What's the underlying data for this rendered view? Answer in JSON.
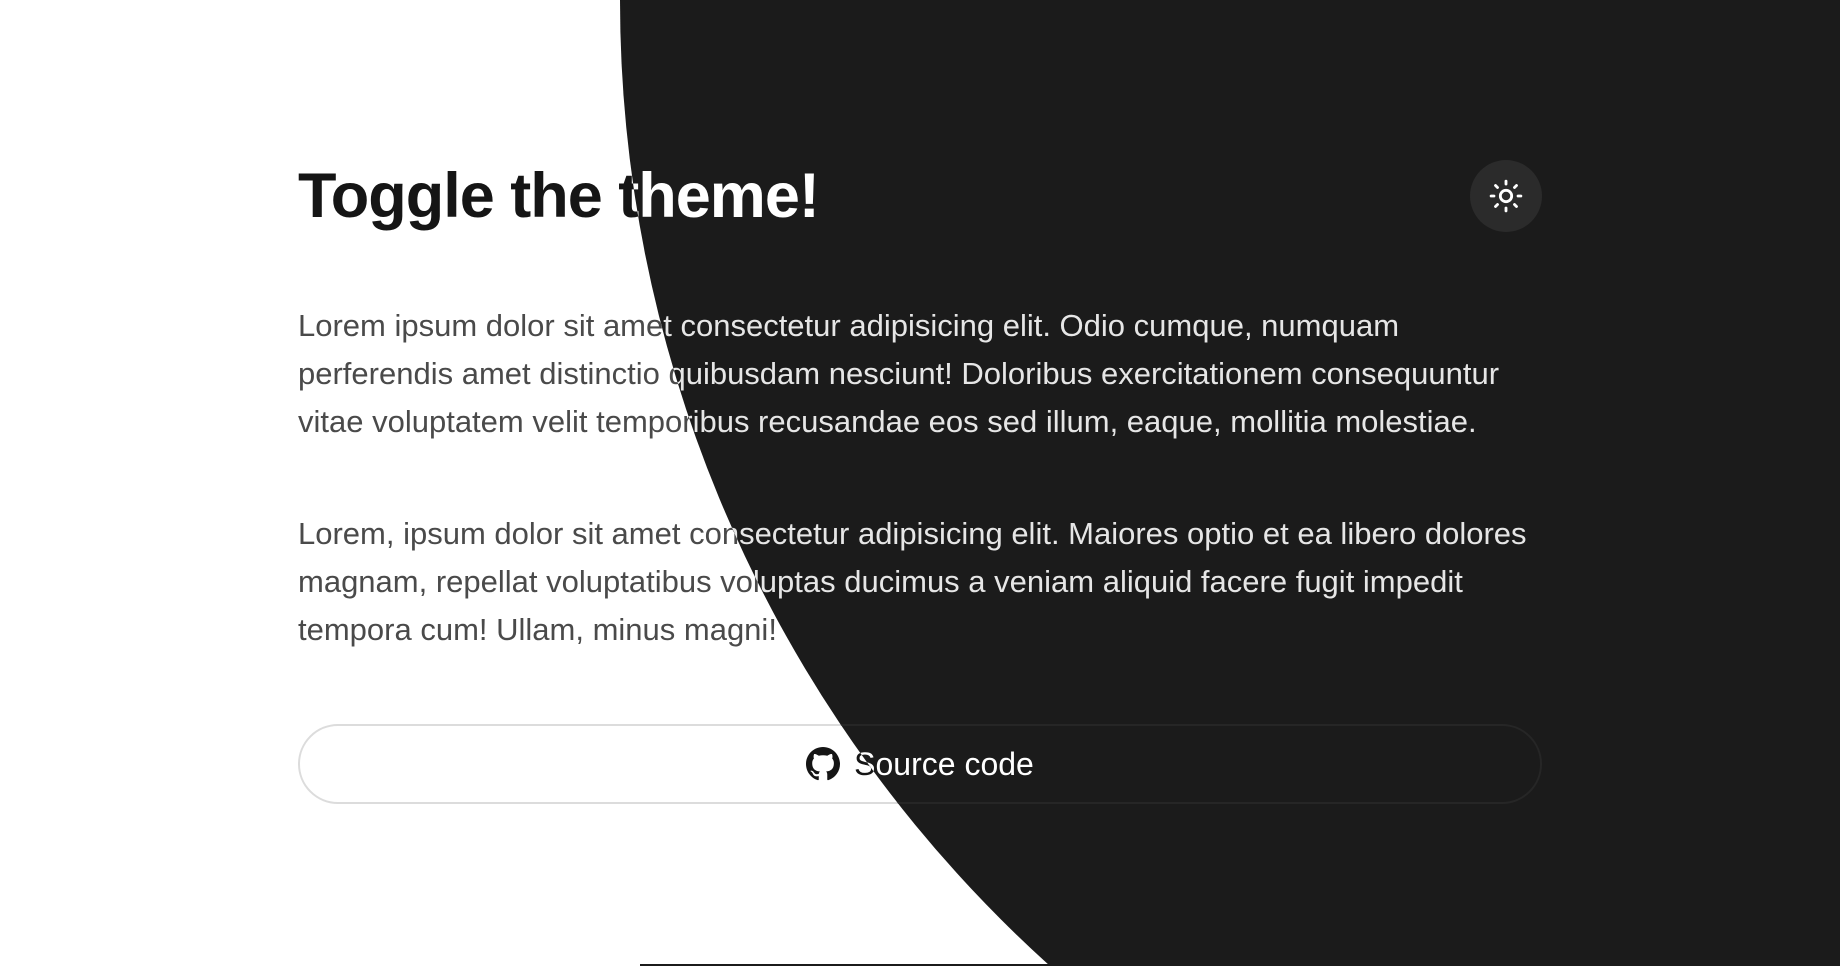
{
  "header": {
    "title": "Toggle the theme!"
  },
  "theme_toggle": {
    "icon": "sun-icon"
  },
  "content": {
    "paragraph_1": "Lorem ipsum dolor sit amet consectetur adipisicing elit. Odio cumque, numquam perferendis amet distinctio quibusdam nesciunt! Doloribus exercitationem consequuntur vitae voluptatem velit temporibus recusandae eos sed illum, eaque, mollitia molestiae.",
    "paragraph_2": "Lorem, ipsum dolor sit amet consectetur adipisicing elit. Maiores optio et ea libero dolores magnam, repellat voluptatibus voluptas ducimus a veniam aliquid facere fugit impedit tempora cum! Ullam, minus magni!"
  },
  "source_button": {
    "label": "Source code",
    "icon": "github-icon"
  },
  "colors": {
    "light_background": "#ffffff",
    "dark_background": "#1b1b1b",
    "light_text": "#151515",
    "dark_text": "#ffffff"
  }
}
